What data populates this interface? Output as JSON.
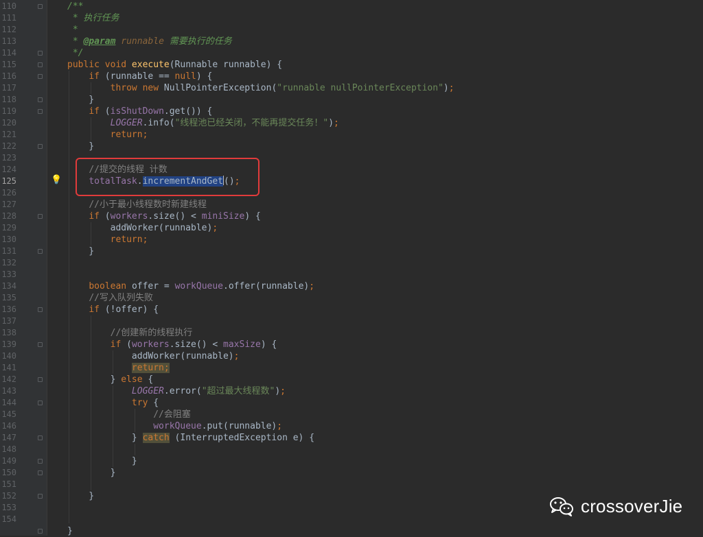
{
  "editor": {
    "current_line": "125",
    "line_numbers": [
      "110",
      "111",
      "112",
      "113",
      "114",
      "115",
      "116",
      "117",
      "118",
      "119",
      "120",
      "121",
      "122",
      "123",
      "124",
      "125",
      "126",
      "127",
      "128",
      "129",
      "130",
      "131",
      "132",
      "133",
      "134",
      "135",
      "136",
      "137",
      "138",
      "139",
      "140",
      "141",
      "142",
      "143",
      "144",
      "145",
      "146",
      "147",
      "148",
      "149",
      "150",
      "151",
      "152",
      "153",
      "154"
    ],
    "code": {
      "l110": "/**",
      "l111_cmt": "执行任务",
      "l113_tag": "@param",
      "l113_name": "runnable",
      "l113_desc": "需要执行的任务",
      "l114": "*/",
      "comment_submit": "//提交的线程 计数",
      "comment_min": "//小于最小线程数时新建线程",
      "comment_write": "//写入队列失败",
      "comment_create": "//创建新的线程执行",
      "comment_block": "//会阻塞",
      "str_npe": "\"runnable nullPointerException\"",
      "str_shutdown": "\"线程池已经关闭，不能再提交任务！\"",
      "str_max": "\"超过最大线程数\"",
      "selected_method": "incrementAndGet"
    }
  },
  "watermark": {
    "icon": "wechat-icon",
    "text": "crossoverJie"
  },
  "colors": {
    "background": "#2b2b2b",
    "gutter": "#313335",
    "keyword": "#cc7832",
    "string": "#6a8759",
    "field": "#9876aa",
    "method": "#ffc66d",
    "comment": "#808080",
    "highlight_box": "#e23b3b"
  }
}
